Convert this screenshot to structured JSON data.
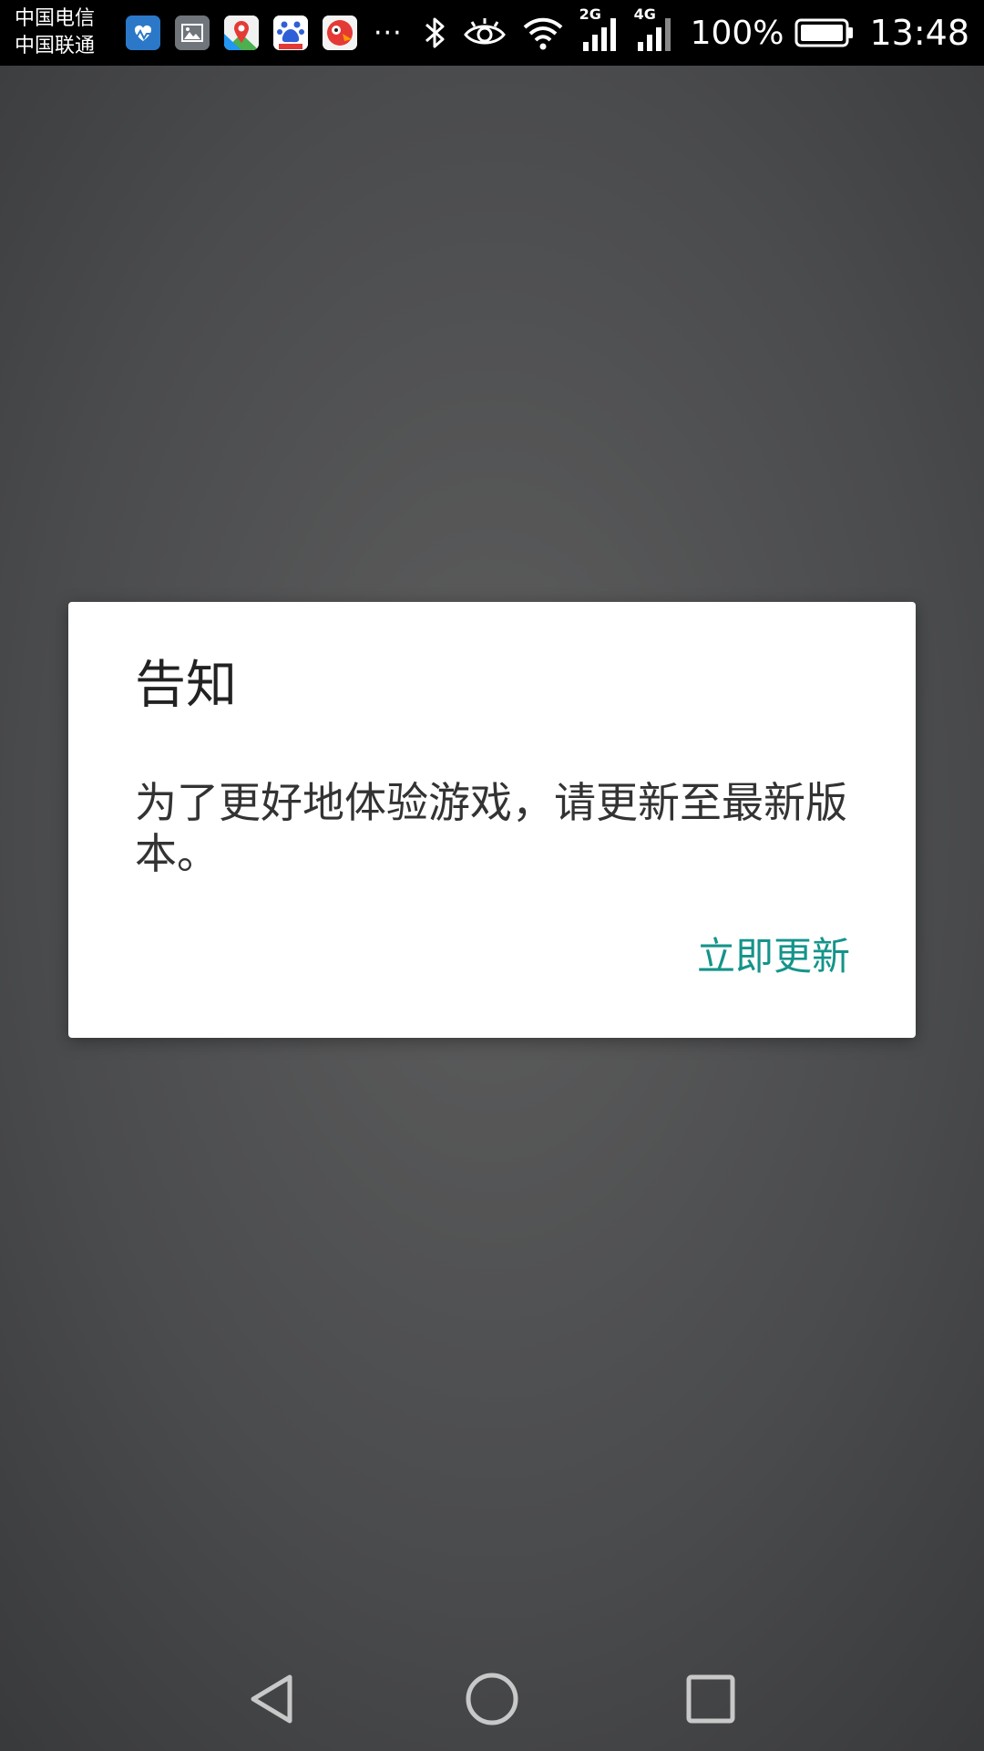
{
  "status_bar": {
    "carrier_1": "中国电信",
    "carrier_2": "中国联通",
    "notification_icons": [
      "health-app-icon",
      "gallery-icon",
      "maps-icon",
      "baidu-icon",
      "app-icon"
    ],
    "more": "···",
    "network_1": "2G",
    "network_2": "4G",
    "battery_percent": "100%",
    "battery_level": 1.0,
    "time": "13:48"
  },
  "dialog": {
    "title": "告知",
    "message": "为了更好地体验游戏，请更新至最新版本。",
    "action_label": "立即更新",
    "action_color": "#14948a"
  },
  "nav_bar": {
    "buttons": [
      "back-icon",
      "home-icon",
      "recents-icon"
    ]
  }
}
